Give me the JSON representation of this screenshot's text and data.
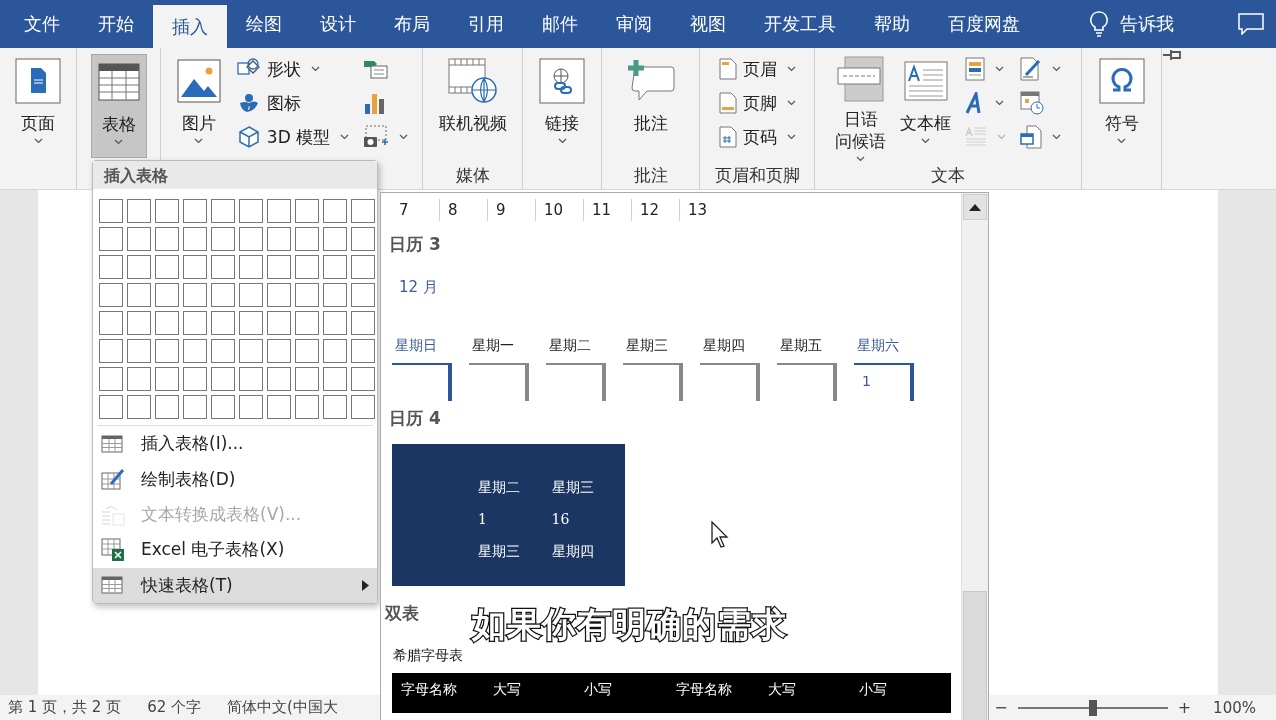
{
  "tabs": [
    {
      "label": "文件",
      "selected": false
    },
    {
      "label": "开始",
      "selected": false
    },
    {
      "label": "插入",
      "selected": true
    },
    {
      "label": "绘图",
      "selected": false
    },
    {
      "label": "设计",
      "selected": false
    },
    {
      "label": "布局",
      "selected": false
    },
    {
      "label": "引用",
      "selected": false
    },
    {
      "label": "邮件",
      "selected": false
    },
    {
      "label": "审阅",
      "selected": false
    },
    {
      "label": "视图",
      "selected": false
    },
    {
      "label": "开发工具",
      "selected": false
    },
    {
      "label": "帮助",
      "selected": false
    },
    {
      "label": "百度网盘",
      "selected": false
    }
  ],
  "tell_me": "告诉我",
  "ribbon": {
    "groups": [
      {
        "items": [
          {
            "kind": "large",
            "label": "页面",
            "dropdown": true,
            "pressed": false,
            "disabled": false
          }
        ]
      },
      {
        "items": [
          {
            "kind": "large",
            "label": "表格",
            "dropdown": true,
            "pressed": true,
            "disabled": false
          }
        ]
      },
      {
        "items": [
          {
            "kind": "large",
            "label": "图片",
            "dropdown": true,
            "pressed": false,
            "disabled": false
          },
          {
            "kind": "small",
            "label": "形状",
            "dropdown": true,
            "pressed": false,
            "disabled": false
          },
          {
            "kind": "small",
            "label": "图标",
            "dropdown": false,
            "pressed": false,
            "disabled": false
          },
          {
            "kind": "small",
            "label": "3D 模型",
            "dropdown": true,
            "pressed": false,
            "disabled": false
          },
          {
            "kind": "icon",
            "dropdown": false,
            "pressed": false,
            "disabled": false
          },
          {
            "kind": "icon",
            "dropdown": false,
            "pressed": false,
            "disabled": false
          },
          {
            "kind": "icon",
            "dropdown": true,
            "pressed": false,
            "disabled": false
          }
        ]
      },
      {
        "label": "媒体",
        "items": [
          {
            "kind": "large",
            "label": "联机视频",
            "dropdown": false,
            "pressed": false,
            "disabled": false
          }
        ]
      },
      {
        "items": [
          {
            "kind": "large",
            "label": "链接",
            "dropdown": true,
            "pressed": false,
            "disabled": false
          }
        ]
      },
      {
        "label": "批注",
        "items": [
          {
            "kind": "large",
            "label": "批注",
            "dropdown": false,
            "pressed": false,
            "disabled": false
          }
        ]
      },
      {
        "label": "页眉和页脚",
        "items": [
          {
            "kind": "small",
            "label": "页眉",
            "dropdown": true,
            "pressed": false,
            "disabled": false
          },
          {
            "kind": "small",
            "label": "页脚",
            "dropdown": true,
            "pressed": false,
            "disabled": false
          },
          {
            "kind": "small",
            "label": "页码",
            "dropdown": true,
            "pressed": false,
            "disabled": false
          }
        ]
      },
      {
        "label": "文本",
        "items": [
          {
            "kind": "large",
            "lines": [
              "日语",
              "问候语"
            ],
            "dropdown": true,
            "pressed": false,
            "disabled": false
          },
          {
            "kind": "large",
            "label": "文本框",
            "dropdown": true,
            "pressed": false,
            "disabled": false
          },
          {
            "kind": "icon",
            "dropdown": true,
            "pressed": false,
            "disabled": false
          },
          {
            "kind": "icon",
            "dropdown": true,
            "pressed": false,
            "disabled": false
          },
          {
            "kind": "icon",
            "dropdown": true,
            "pressed": false,
            "disabled": true
          },
          {
            "kind": "icon",
            "dropdown": true,
            "pressed": false,
            "disabled": false
          },
          {
            "kind": "icon",
            "dropdown": false,
            "pressed": false,
            "disabled": false
          },
          {
            "kind": "icon",
            "dropdown": true,
            "pressed": false,
            "disabled": false
          }
        ]
      },
      {
        "items": [
          {
            "kind": "large",
            "label": "符号",
            "dropdown": true,
            "pressed": false,
            "disabled": false
          }
        ]
      }
    ]
  },
  "table_menu": {
    "title": "插入表格",
    "items": [
      {
        "label": "插入表格(I)...",
        "disabled": false,
        "highlighted": false,
        "submenu": false
      },
      {
        "label": "绘制表格(D)",
        "disabled": false,
        "highlighted": false,
        "submenu": false
      },
      {
        "label": "文本转换成表格(V)...",
        "disabled": true,
        "highlighted": false,
        "submenu": false
      },
      {
        "label": "Excel 电子表格(X)",
        "disabled": false,
        "highlighted": false,
        "submenu": false
      },
      {
        "label": "快速表格(T)",
        "disabled": false,
        "highlighted": true,
        "submenu": true
      }
    ]
  },
  "quick_tables": {
    "number_row": [
      "7",
      "8",
      "9",
      "10",
      "11",
      "12",
      "13"
    ],
    "calendar3": {
      "title": "日历 3",
      "month": "12 月",
      "days": [
        {
          "label": "星期日",
          "weekend": true
        },
        {
          "label": "星期一",
          "weekend": false
        },
        {
          "label": "星期二",
          "weekend": false
        },
        {
          "label": "星期三",
          "weekend": false
        },
        {
          "label": "星期四",
          "weekend": false
        },
        {
          "label": "星期五",
          "weekend": false
        },
        {
          "label": "星期六",
          "weekend": true,
          "date": "1"
        }
      ]
    },
    "calendar4": {
      "title": "日历 4",
      "rows": [
        [
          "星期二",
          "星期三"
        ],
        [
          "1",
          "16"
        ],
        [
          "星期三",
          "星期四"
        ]
      ]
    },
    "double_table": {
      "title": "双表",
      "caption": "希腊字母表",
      "columns": [
        "字母名称",
        "大写",
        "小写",
        "字母名称",
        "大写",
        "小写"
      ]
    }
  },
  "subtitle": "如果你有明确的需求",
  "status_bar": {
    "page": "第 1 页，共 2 页",
    "words": "62 个字",
    "language": "简体中文(中国大",
    "zoom_out": "−",
    "zoom_in": "+",
    "zoom": {
      "level": 0.5
    },
    "zoom_percent": "100%"
  }
}
